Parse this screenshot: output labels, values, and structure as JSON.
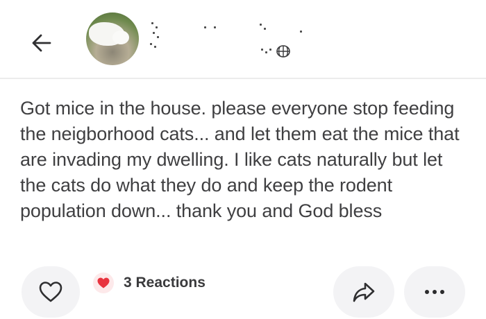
{
  "post": {
    "text": "Got mice in the house. please everyone stop feeding the neigborhood cats... and let them eat the mice that are invading my dwelling. I like cats naturally but let the cats do what they do and keep the rodent population down... thank you and God bless"
  },
  "reactions": {
    "label": "3 Reactions"
  },
  "icons": {
    "back": "arrow-left-icon",
    "privacy": "globe-icon",
    "like": "heart-outline-icon",
    "reaction": "heart-filled-icon",
    "share": "share-arrow-icon",
    "more": "more-dots-icon"
  },
  "colors": {
    "text": "#3f3f41",
    "button_bg": "#f3f3f5",
    "reaction_heart": "#e8343f",
    "reaction_bg": "#fde9ea"
  }
}
